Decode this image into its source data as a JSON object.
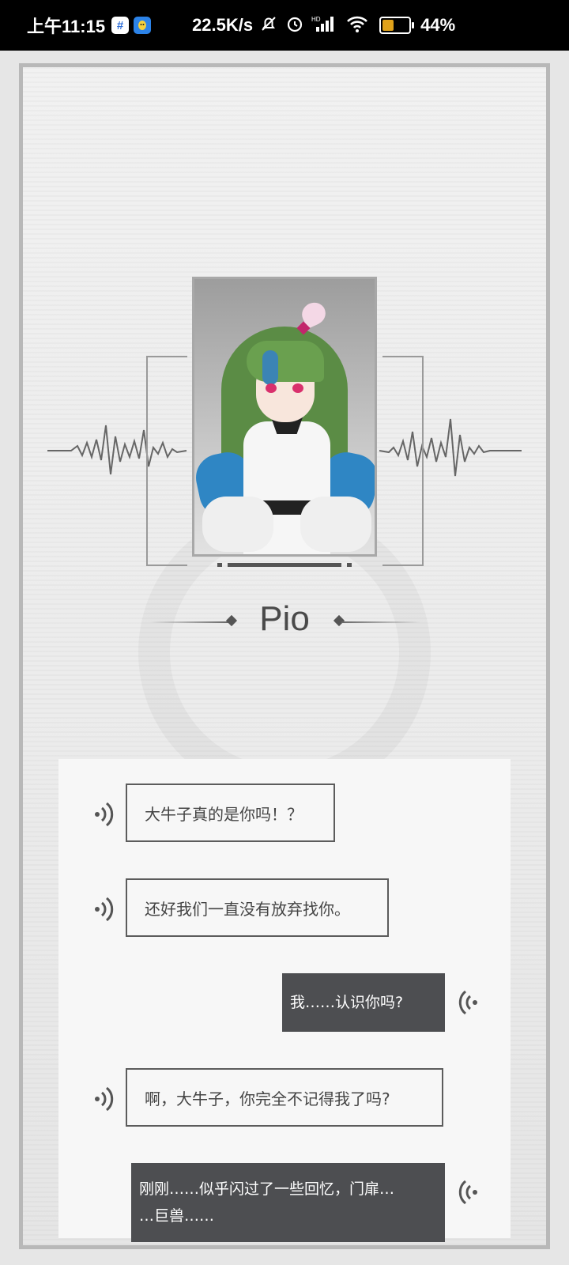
{
  "status_bar": {
    "time": "上午11:15",
    "app_icon_1": "#",
    "speed": "22.5K/s",
    "battery_percent": "44%",
    "battery_level": 0.44,
    "icons": [
      "hashtag-app-icon",
      "qq-app-icon",
      "bell-muted-icon",
      "alarm-icon",
      "hd-signal-icon",
      "wifi-icon",
      "battery-icon"
    ]
  },
  "speaker": {
    "name": "Pio"
  },
  "dialogue": [
    {
      "side": "left",
      "text": "大牛子真的是你吗！？"
    },
    {
      "side": "left",
      "text": "还好我们一直没有放弃找你。"
    },
    {
      "side": "right",
      "text": "我……认识你吗?"
    },
    {
      "side": "left",
      "text": "啊，大牛子，你完全不记得我了吗?"
    },
    {
      "side": "right",
      "line1": "刚刚……似乎闪过了一些回忆，门扉…",
      "line2": "…巨兽……"
    }
  ],
  "colors": {
    "frame": "#b8b8b8",
    "reply_bubble": "#4d4e51",
    "battery_fill": "#e0a21a"
  }
}
